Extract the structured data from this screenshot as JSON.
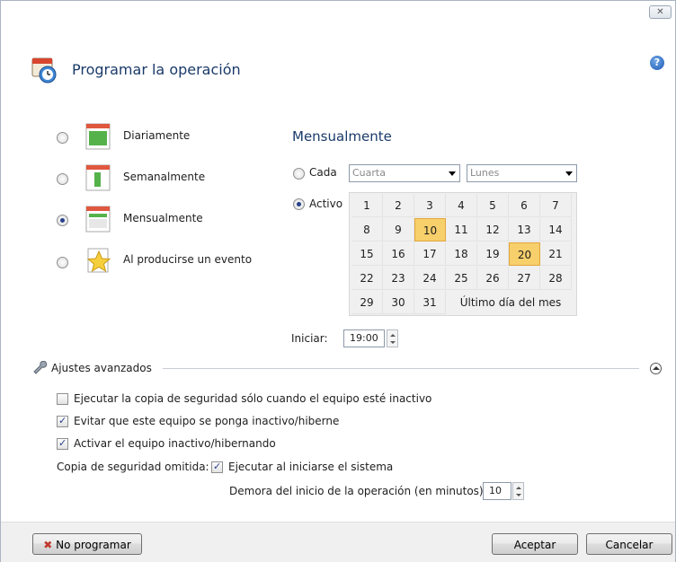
{
  "window": {
    "close_glyph": "✕"
  },
  "header": {
    "title": "Programar la operación",
    "help_glyph": "?"
  },
  "schedule_options": [
    {
      "label": "Diariamente",
      "selected": false,
      "icon": "calendar-daily-icon"
    },
    {
      "label": "Semanalmente",
      "selected": false,
      "icon": "calendar-weekly-icon"
    },
    {
      "label": "Mensualmente",
      "selected": true,
      "icon": "calendar-monthly-icon"
    },
    {
      "label": "Al producirse un evento",
      "selected": false,
      "icon": "event-star-icon"
    }
  ],
  "monthly": {
    "title": "Mensualmente",
    "each_label": "Cada",
    "each_ordinal": "Cuarta",
    "each_weekday": "Lunes",
    "active_label": "Activo",
    "days": [
      [
        "1",
        "2",
        "3",
        "4",
        "5",
        "6",
        "7"
      ],
      [
        "8",
        "9",
        "10",
        "11",
        "12",
        "13",
        "14"
      ],
      [
        "15",
        "16",
        "17",
        "18",
        "19",
        "20",
        "21"
      ],
      [
        "22",
        "23",
        "24",
        "25",
        "26",
        "27",
        "28"
      ],
      [
        "29",
        "30",
        "31"
      ]
    ],
    "selected_days": [
      "10",
      "20"
    ],
    "last_day_label": "Último día del mes",
    "start_label": "Iniciar:",
    "start_time": "19:00"
  },
  "advanced": {
    "title": "Ajustes avanzados",
    "option_inactive": "Ejecutar la copia de seguridad sólo cuando el equipo esté inactivo",
    "option_inactive_checked": false,
    "option_prevent_sleep": "Evitar que este equipo se ponga inactivo/hiberne",
    "option_prevent_sleep_checked": true,
    "option_wake": "Activar el equipo inactivo/hibernando",
    "option_wake_checked": true,
    "skipped_label": "Copia de seguridad omitida:",
    "run_at_startup": "Ejecutar al iniciarse el sistema",
    "run_at_startup_checked": true,
    "delay_label": "Demora del inicio de la operación (en minutos):",
    "delay_value": "10"
  },
  "footer": {
    "no_schedule": "No programar",
    "accept": "Aceptar",
    "cancel": "Cancelar"
  }
}
